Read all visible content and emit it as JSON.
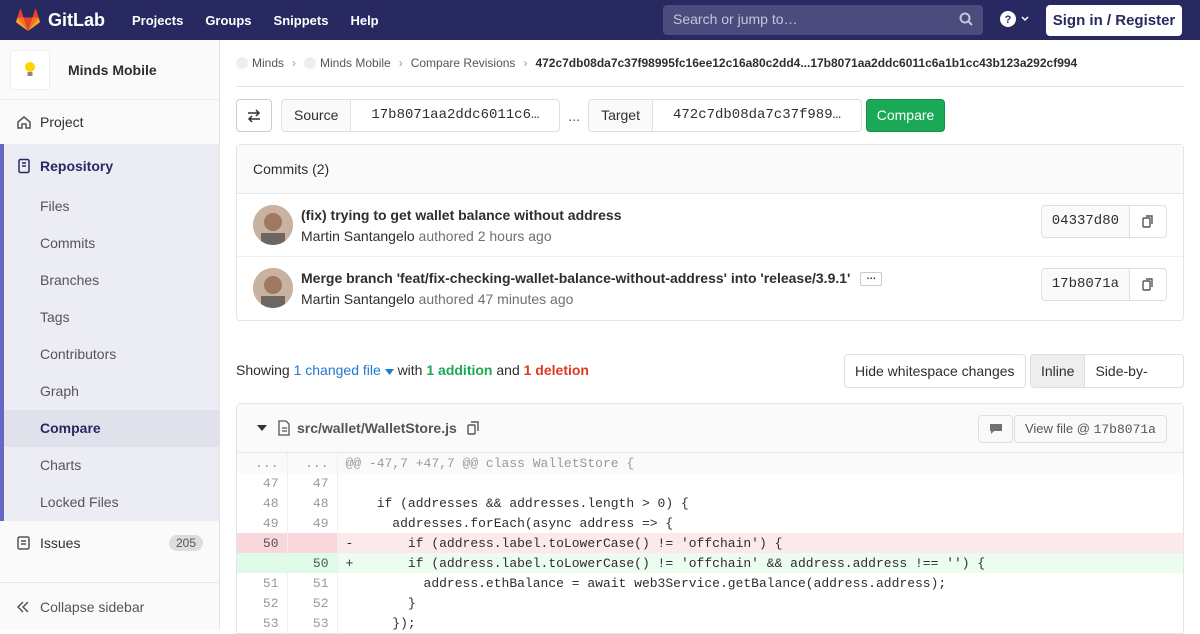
{
  "topbar": {
    "brand": "GitLab",
    "nav": [
      "Projects",
      "Groups",
      "Snippets",
      "Help"
    ],
    "search_placeholder": "Search or jump to…",
    "signin": "Sign in / Register"
  },
  "sidebar": {
    "project": "Minds Mobile",
    "project_nav": "Project",
    "repository": "Repository",
    "items": [
      "Files",
      "Commits",
      "Branches",
      "Tags",
      "Contributors",
      "Graph",
      "Compare",
      "Charts",
      "Locked Files"
    ],
    "issues": "Issues",
    "issues_count": "205",
    "collapse": "Collapse sidebar"
  },
  "breadcrumb": {
    "group": "Minds",
    "project": "Minds Mobile",
    "section": "Compare Revisions",
    "current": "472c7db08da7c37f98995fc16ee12c16a80c2dd4...17b8071aa2ddc6011c6a1b1cc43b123a292cf994"
  },
  "compare": {
    "source_label": "Source",
    "source_value": "17b8071aa2ddc6011c6…",
    "separator": "...",
    "target_label": "Target",
    "target_value": "472c7db08da7c37f989…",
    "button": "Compare"
  },
  "commits": {
    "header": "Commits (2)",
    "rows": [
      {
        "title": "(fix) trying to get wallet balance without address",
        "author": "Martin Santangelo",
        "authored": "authored 2 hours ago",
        "sha": "04337d80"
      },
      {
        "title": "Merge branch 'feat/fix-checking-wallet-balance-without-address' into 'release/3.9.1'",
        "author": "Martin Santangelo",
        "authored": "authored 47 minutes ago",
        "sha": "17b8071a"
      }
    ]
  },
  "stats": {
    "showing": "Showing",
    "changed": "1 changed file",
    "with": "with",
    "additions": "1 addition",
    "and": "and",
    "deletions": "1 deletion"
  },
  "view": {
    "whitespace": "Hide whitespace changes",
    "inline": "Inline",
    "side": "Side-by-side"
  },
  "file": {
    "path": "src/wallet/WalletStore.js",
    "view_label": "View file @",
    "view_sha": "17b8071a"
  },
  "diff": [
    {
      "type": "match",
      "old": "...",
      "new": "...",
      "code": "@@ -47,7 +47,7 @@ class WalletStore {"
    },
    {
      "type": "ctx",
      "old": "47",
      "new": "47",
      "code": ""
    },
    {
      "type": "ctx",
      "old": "48",
      "new": "48",
      "code": "    if (addresses && addresses.length > 0) {"
    },
    {
      "type": "ctx",
      "old": "49",
      "new": "49",
      "code": "      addresses.forEach(async address => {"
    },
    {
      "type": "old",
      "old": "50",
      "new": "",
      "code": "-       if (address.label.toLowerCase() != 'offchain') {"
    },
    {
      "type": "new",
      "old": "",
      "new": "50",
      "code": "+       if (address.label.toLowerCase() != 'offchain' && address.address !== '') {"
    },
    {
      "type": "ctx",
      "old": "51",
      "new": "51",
      "code": "          address.ethBalance = await web3Service.getBalance(address.address);"
    },
    {
      "type": "ctx",
      "old": "52",
      "new": "52",
      "code": "        }"
    },
    {
      "type": "ctx",
      "old": "53",
      "new": "53",
      "code": "      });"
    }
  ]
}
